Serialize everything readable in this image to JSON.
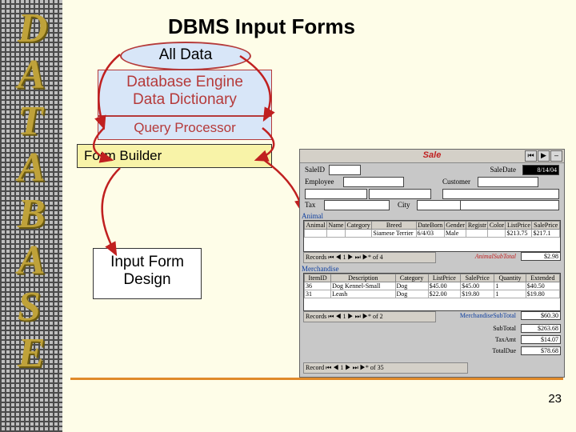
{
  "sidebar_letters": [
    "D",
    "A",
    "T",
    "A",
    "B",
    "A",
    "S",
    "E"
  ],
  "title": "DBMS Input Forms",
  "boxes": {
    "all_data": "All Data",
    "engine_l1": "Database Engine",
    "engine_l2": "Data Dictionary",
    "query": "Query Processor",
    "form_builder": "Form Builder",
    "input_form_l1": "Input Form",
    "input_form_l2": "Design"
  },
  "pagenum": "23",
  "form": {
    "window_title": "Sale",
    "labels": {
      "sale_id": "SaleID",
      "sale_date": "SaleDate",
      "employee": "Employee",
      "customer": "Customer",
      "tax": "Tax",
      "city": "City",
      "animal": "Animal",
      "merchandise": "Merchandise"
    },
    "fields": {
      "sale_date_val": "8/14/04"
    },
    "animal_headers": [
      "Animal",
      "Name",
      "Category",
      "Breed",
      "DateBorn",
      "Gender",
      "Registr",
      "Color",
      "ListPrice",
      "SalePrice"
    ],
    "animal_row": [
      "",
      "",
      "",
      "Siamese Terrier",
      "6/4/03",
      "Male",
      "",
      "",
      "$213.75",
      "$217.1"
    ],
    "merch_headers": [
      "ItemID",
      "Description",
      "Category",
      "ListPrice",
      "SalePrice",
      "Quantity",
      "Extended"
    ],
    "merch_rows": [
      [
        "36",
        "Dog Kennel-Small",
        "Dog",
        "$45.00",
        "$45.00",
        "1",
        "$40.50"
      ],
      [
        "31",
        "Leash",
        "Dog",
        "$22.00",
        "$19.80",
        "1",
        "$19.80"
      ]
    ],
    "recordnav1": "Records  ⏮ ◀ 1 ▶ ⏭ ▶* of 4",
    "recordnav2": "Records  ⏮ ◀ 1 ▶ ⏭ ▶* of 2",
    "recordnav3": "Record   ⏮ ◀ 1 ▶ ⏭ ▶* of 35",
    "subtotals": {
      "animal_sub_lab": "AnimalSubTotal",
      "animal_sub": "$2.98",
      "merch_sub_lab": "MerchandiseSubTotal",
      "merch_sub": "$60.30",
      "subtotal_lab": "SubTotal",
      "subtotal": "$263.68",
      "tax_lab": "TaxAmt",
      "tax": "$14.07",
      "total_lab": "TotalDue",
      "total": "$78.68"
    }
  }
}
